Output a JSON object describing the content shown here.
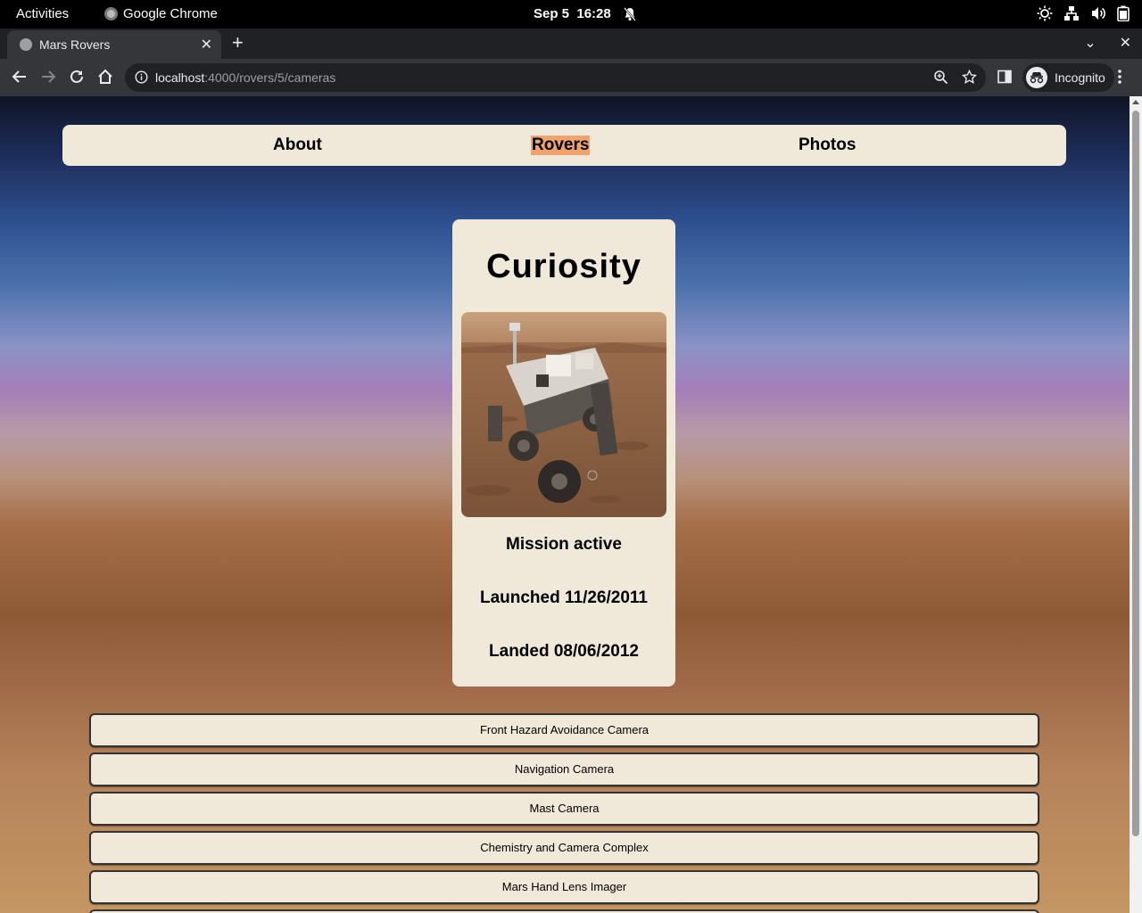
{
  "system_bar": {
    "activities": "Activities",
    "app_name": "Google Chrome",
    "date": "Sep 5",
    "time": "16:28"
  },
  "browser": {
    "tab_title": "Mars Rovers",
    "url_host": "localhost",
    "url_path": ":4000/rovers/5/cameras",
    "profile_label": "Incognito"
  },
  "site_nav": {
    "items": [
      {
        "label": "About",
        "active": false
      },
      {
        "label": "Rovers",
        "active": true
      },
      {
        "label": "Photos",
        "active": false
      }
    ]
  },
  "rover": {
    "name": "Curiosity",
    "status": "Mission active",
    "launched": "Launched 11/26/2011",
    "landed": "Landed 08/06/2012"
  },
  "cameras": [
    "Front Hazard Avoidance Camera",
    "Navigation Camera",
    "Mast Camera",
    "Chemistry and Camera Complex",
    "Mars Hand Lens Imager"
  ],
  "colors": {
    "panel": "#f0e8d8",
    "active_nav_highlight": "#f0a36c"
  }
}
